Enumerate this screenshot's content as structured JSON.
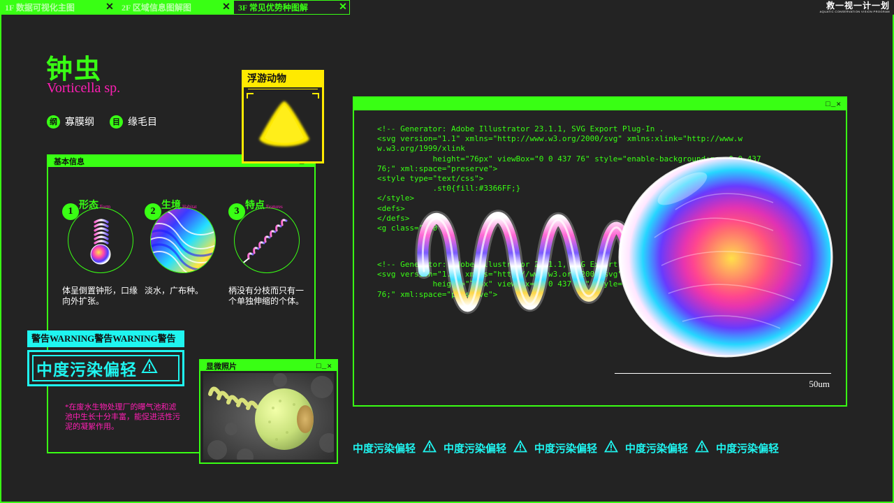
{
  "tabs": [
    {
      "label": "1F 数据可视化主图",
      "close": "✕",
      "active": false
    },
    {
      "label": "2F 区域信息图解图",
      "close": "✕",
      "active": false
    },
    {
      "label": "3F 常见优势种图解",
      "close": "✕",
      "active": true
    }
  ],
  "brand": {
    "title": "救一视一计一划",
    "subtitle": "AQUATIC CONSERVATION VISION PROGRAM"
  },
  "species": {
    "name_cn": "钟虫",
    "name_latin": "Vorticella sp.",
    "taxonomy": [
      {
        "badge": "纲",
        "value": "寡膜纲"
      },
      {
        "badge": "目",
        "value": "缘毛目"
      }
    ]
  },
  "category_card": {
    "label": "浮游动物"
  },
  "window_controls": "□_✕",
  "info_window": {
    "title": "基本信息",
    "features": [
      {
        "num": "1",
        "title": "形态",
        "title_en": "Form",
        "desc": "体呈倒置钟形，口缘向外扩张。"
      },
      {
        "num": "2",
        "title": "生境",
        "title_en": "Habitat",
        "desc": "淡水，广布种。"
      },
      {
        "num": "3",
        "title": "特点",
        "title_en": "Features",
        "desc": "柄没有分枝而只有一个单独伸缩的个体。"
      }
    ]
  },
  "warning": {
    "strip": "警告WARNING警告WARNING警告",
    "level": "中度污染偏轻",
    "note": "*在废水生物处理厂的曝气池和滤池中生长十分丰富，能促进活性污泥的凝絮作用。"
  },
  "photo_window": {
    "title": "显微照片"
  },
  "main_window": {
    "code_top": "<!-- Generator: Adobe Illustrator 23.1.1, SVG Export Plug-In .\n<svg version=\"1.1\" xmlns=\"http://www.w3.org/2000/svg\" xmlns:xlink=\"http://www.w\nw.w3.org/1999/xlink\n            height=\"76px\" viewBox=\"0 0 437 76\" style=\"enable-background:new 0 0 437\n76;\" xml:space=\"preserve\">\n<style type=\"text/css\">\n            .st0{fill:#3366FF;}\n</style>\n<defs>\n</defs>\n<g class=\"st0\">",
    "code_bottom": "<!-- Generator: Adobe Illustrator 23.1.1, SVG Export Plug-In .\n<svg version=\"1.1\" xmlns=\"http://www.w3.org/2000/svg\" xmlns:xlink=\"http://www.w\n            height=\"76px\" viewBox=\"0 0 437 76\" style=\"enable-background:new 0 0 437\n76;\" xml:space=\"preserve\">",
    "scale_label": "50um"
  },
  "ticker": [
    "中度污染偏轻",
    "中度污染偏轻",
    "中度污染偏轻",
    "中度污染偏轻",
    "中度污染偏轻"
  ],
  "colors": {
    "green": "#39ff14",
    "magenta": "#ff1fb4",
    "cyan": "#1ff5f0",
    "yellow": "#ffea00",
    "bg": "#232323"
  }
}
